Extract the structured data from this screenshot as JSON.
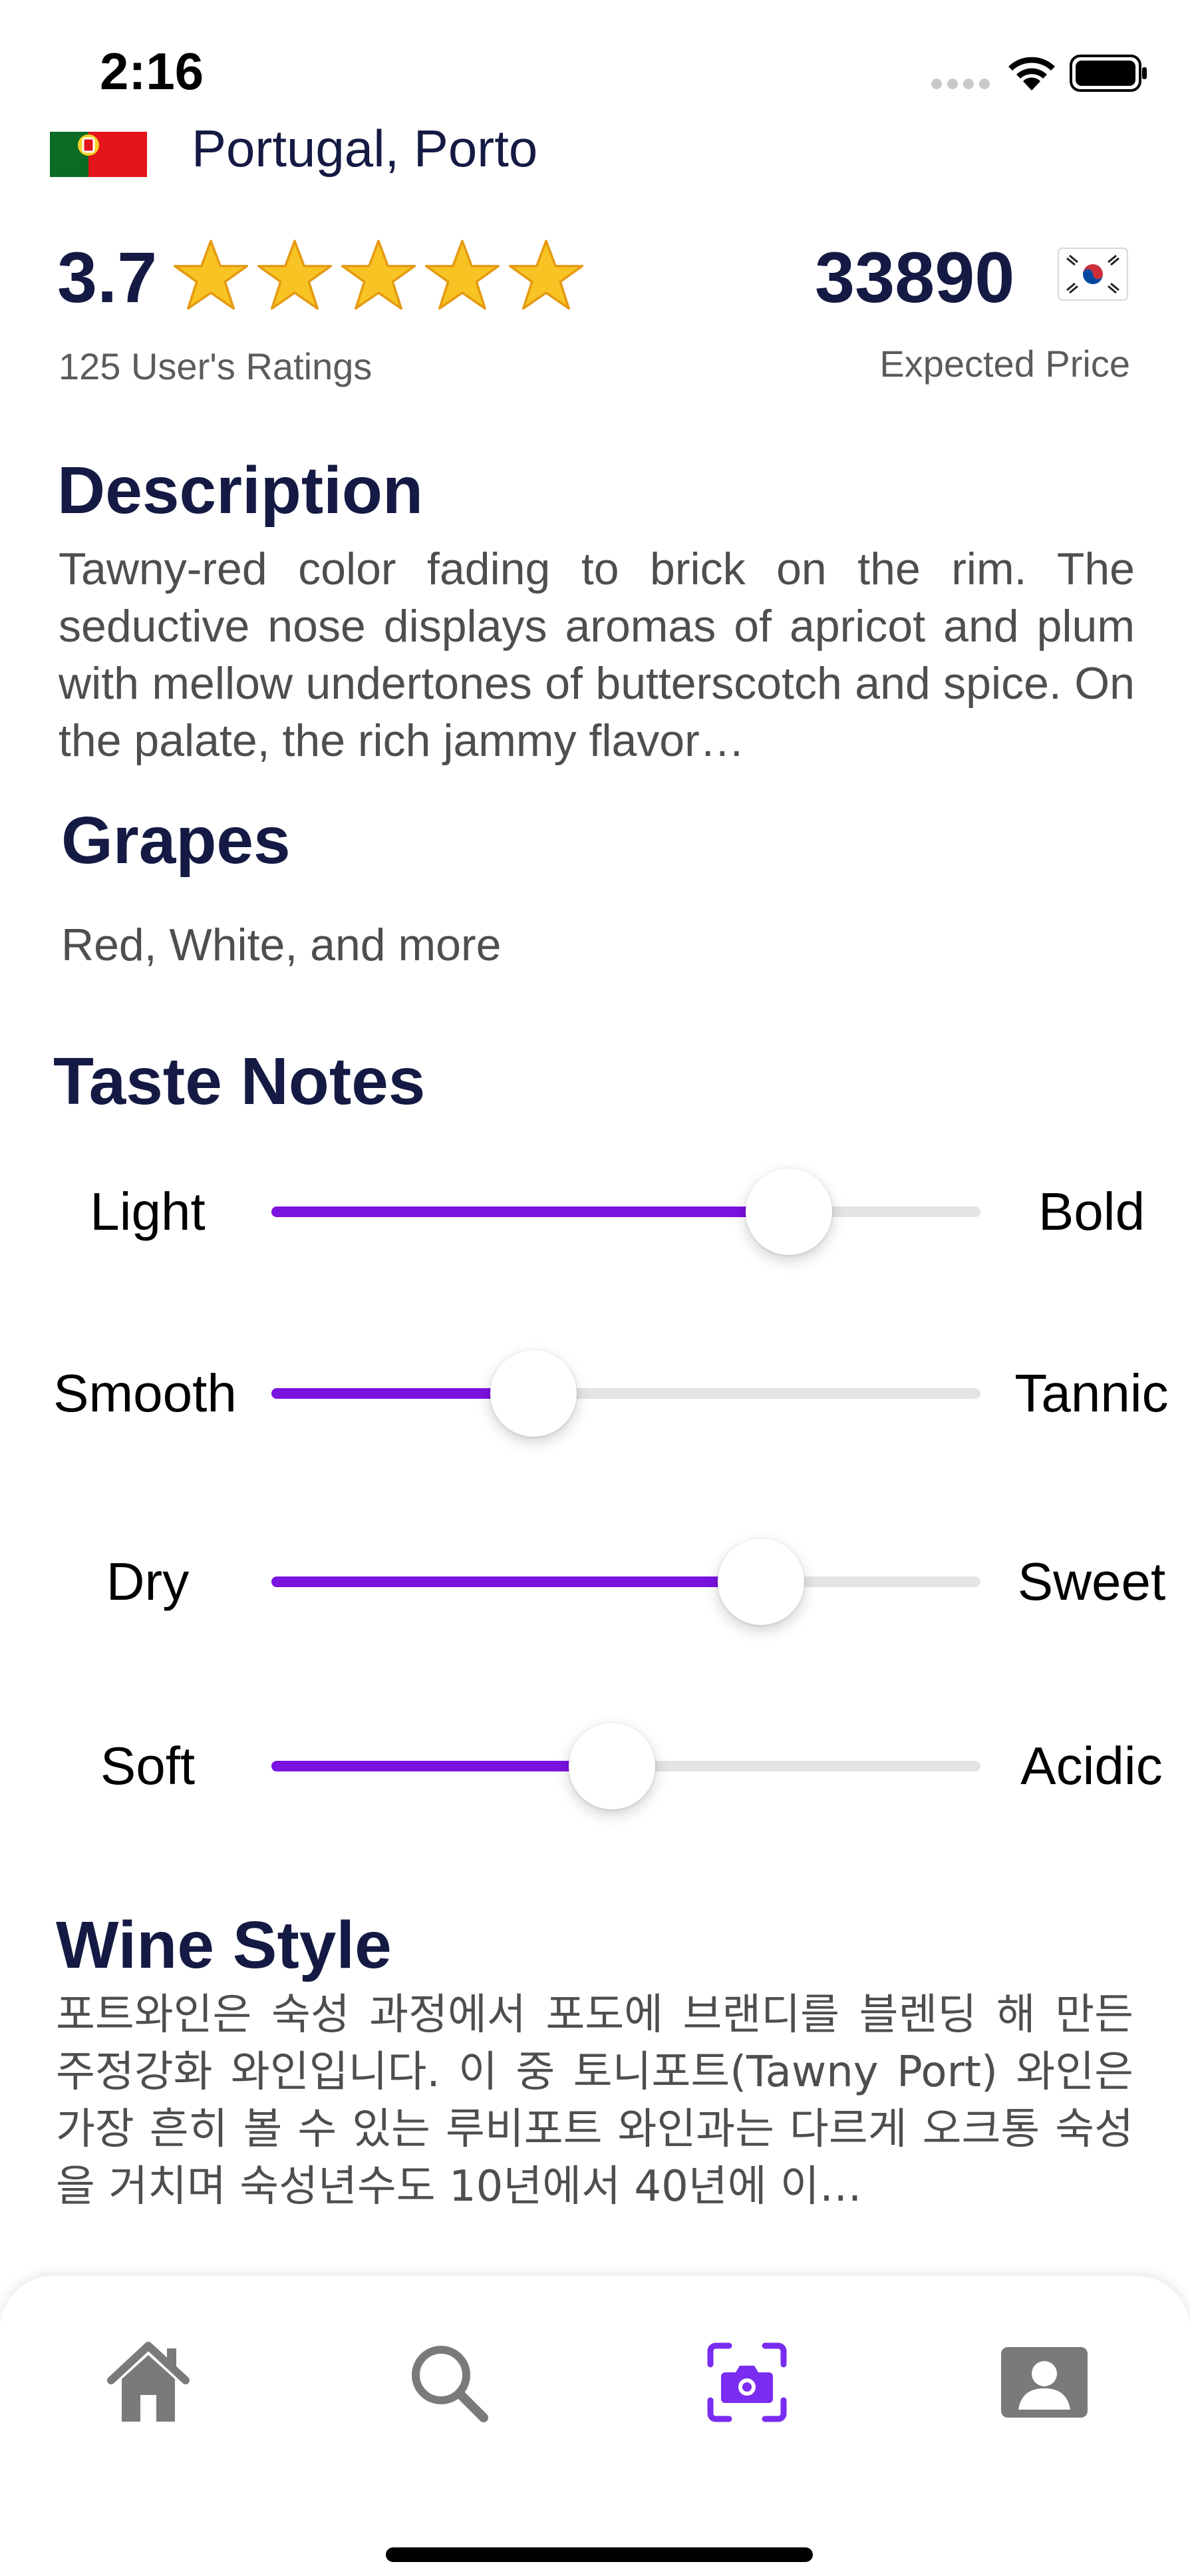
{
  "status_bar": {
    "time": "2:16"
  },
  "wine": {
    "location": "Portugal, Porto",
    "origin_flag": "portugal-flag",
    "rating_value": "3.7",
    "stars": 5,
    "rating_count": "125 User's Ratings",
    "price": "33890",
    "price_flag": "south-korea-flag",
    "price_label": "Expected Price"
  },
  "description": {
    "title": "Description",
    "text": "Tawny-red color fading to brick on the rim.  The seductive nose displays aromas of apricot and plum with mellow undertones of butterscotch and spice.  On the palate, the rich jammy flavor…"
  },
  "grapes": {
    "title": "Grapes",
    "text": "Red, White, and more"
  },
  "taste_notes": {
    "title": "Taste Notes",
    "sliders": [
      {
        "left": "Light",
        "right": "Bold",
        "value": 0.73
      },
      {
        "left": "Smooth",
        "right": "Tannic",
        "value": 0.37
      },
      {
        "left": "Dry",
        "right": "Sweet",
        "value": 0.69
      },
      {
        "left": "Soft",
        "right": "Acidic",
        "value": 0.48
      }
    ]
  },
  "wine_style": {
    "title": "Wine Style",
    "text": "포트와인은 숙성 과정에서 포도에 브랜디를 블렌딩 해 만든 주정강화 와인입니다. 이 중 토니포트(Tawny Port) 와인은 가장 흔히 볼 수 있는 루비포트 와인과는 다르게 오크통 숙성을 거치며 숙성년수도 10년에서 40년에 이…"
  },
  "tab_bar": {
    "items": [
      {
        "icon": "home-icon",
        "active": false
      },
      {
        "icon": "search-icon",
        "active": false
      },
      {
        "icon": "camera-scan-icon",
        "active": true
      },
      {
        "icon": "profile-icon",
        "active": false
      }
    ],
    "active_color": "#7a2cf0",
    "inactive_color": "#7a7a7a"
  },
  "colors": {
    "accent": "#7a12e0",
    "title": "#141a43",
    "body_text": "#4e4e4e"
  }
}
